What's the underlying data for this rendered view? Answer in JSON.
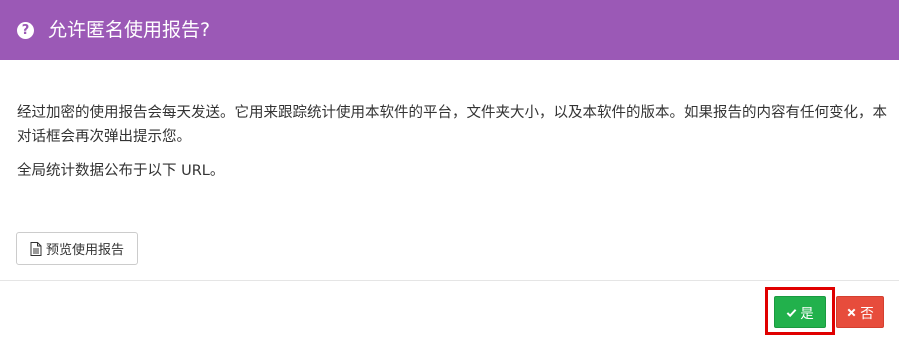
{
  "dialog": {
    "title": "允许匿名使用报告?",
    "header_icon": "question-circle-icon",
    "colors": {
      "header": "#9b59b6",
      "yes_button": "#22b14c",
      "no_button": "#e74c3c",
      "highlight": "#e00000"
    }
  },
  "body": {
    "paragraph1": "经过加密的使用报告会每天发送。它用来跟踪统计使用本软件的平台，文件夹大小，以及本软件的版本。如果报告的内容有任何变化，本对话框会再次弹出提示您。",
    "paragraph2": "全局统计数据公布于以下 URL。"
  },
  "actions": {
    "preview_label": "预览使用报告",
    "preview_icon": "document-icon",
    "yes_label": "是",
    "yes_icon": "check-icon",
    "no_label": "否",
    "no_icon": "close-icon"
  }
}
